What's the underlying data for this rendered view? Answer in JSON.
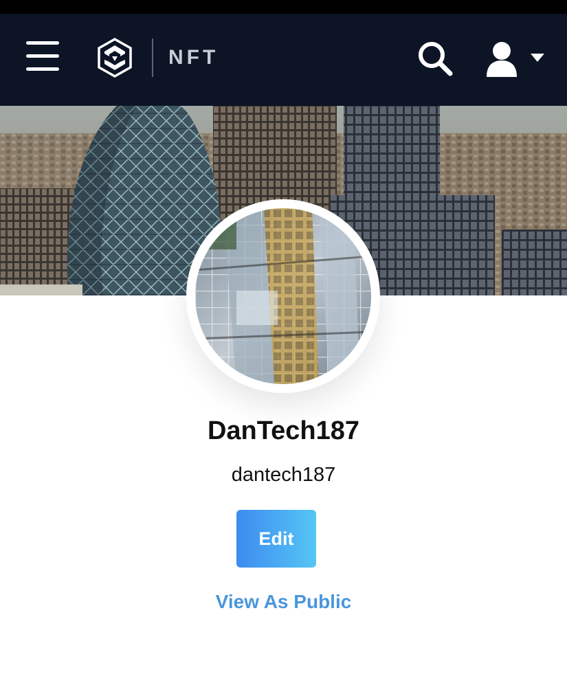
{
  "header": {
    "menu_icon": "hamburger-menu-icon",
    "logo_icon": "crypto-com-logo-icon",
    "logo_text": "NFT",
    "search_icon": "search-icon",
    "user_icon": "user-icon",
    "dropdown_icon": "caret-down-icon",
    "background": "#0c1426"
  },
  "profile": {
    "display_name": "DanTech187",
    "username": "dantech187",
    "edit_label": "Edit",
    "view_public_label": "View As Public",
    "banner_image": "city-skyline-banner-image",
    "avatar_image": "glass-elevator-avatar-image"
  },
  "colors": {
    "accent_blue": "#3d8bf0",
    "accent_light_blue": "#55c6f5",
    "link_blue": "#4a96dc"
  }
}
